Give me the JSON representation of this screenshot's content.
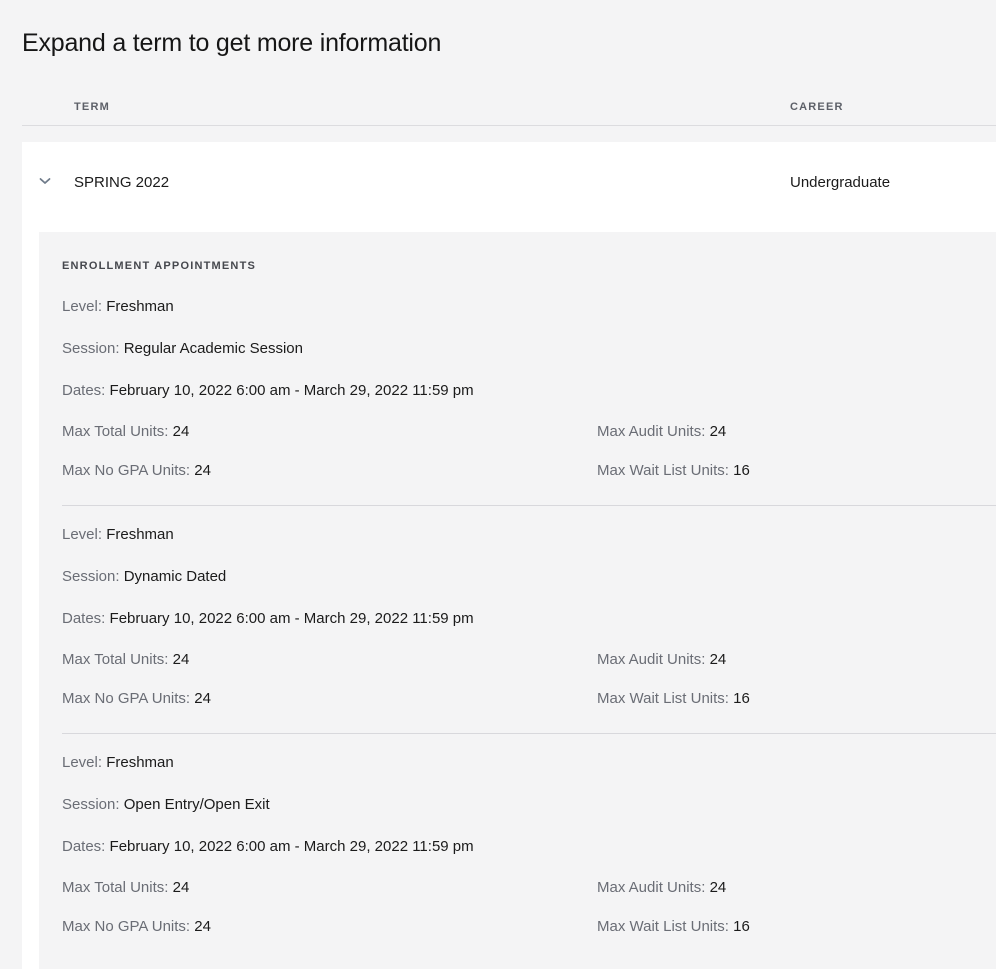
{
  "page": {
    "title": "Expand a term to get more information"
  },
  "table": {
    "headers": {
      "term": "TERM",
      "career": "CAREER"
    }
  },
  "term": {
    "name": "SPRING 2022",
    "career": "Undergraduate",
    "expanded": true,
    "icon": "chevron-down-icon"
  },
  "enrollment": {
    "section_title": "ENROLLMENT APPOINTMENTS",
    "labels": {
      "level": "Level:",
      "session": "Session:",
      "dates": "Dates:",
      "max_total": "Max Total Units:",
      "max_audit": "Max Audit Units:",
      "max_no_gpa": "Max No GPA Units:",
      "max_wait": "Max Wait List Units:"
    },
    "appointments": [
      {
        "level": "Freshman",
        "session": "Regular Academic Session",
        "dates": "February 10, 2022 6:00 am - March 29, 2022 11:59 pm",
        "max_total": "24",
        "max_audit": "24",
        "max_no_gpa": "24",
        "max_wait": "16"
      },
      {
        "level": "Freshman",
        "session": "Dynamic Dated",
        "dates": "February 10, 2022 6:00 am - March 29, 2022 11:59 pm",
        "max_total": "24",
        "max_audit": "24",
        "max_no_gpa": "24",
        "max_wait": "16"
      },
      {
        "level": "Freshman",
        "session": "Open Entry/Open Exit",
        "dates": "February 10, 2022 6:00 am - March 29, 2022 11:59 pm",
        "max_total": "24",
        "max_audit": "24",
        "max_no_gpa": "24",
        "max_wait": "16"
      }
    ]
  },
  "colors": {
    "page_bg": "#f4f4f5",
    "card_bg": "#ffffff",
    "label": "#6a6d75",
    "text": "#1b1b1b",
    "chevron": "#6f7b8a"
  }
}
